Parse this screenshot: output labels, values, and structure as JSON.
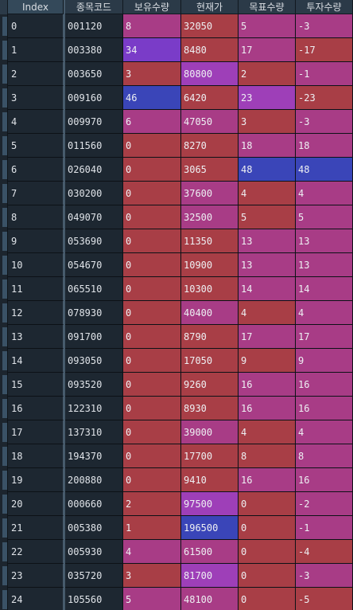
{
  "columns": [
    "Index",
    "종목코드",
    "보유수량",
    "현재가",
    "목표수량",
    "투자수량"
  ],
  "colors": {
    "red": "#a83e46",
    "magenta": "#a83c86",
    "violet": "#7a3cc8",
    "blue": "#3a45b8",
    "purple": "#9e3fb8",
    "dark": "#1d2731"
  },
  "rows": [
    {
      "index": "0",
      "code": "001120",
      "hold": "8",
      "price": "32050",
      "target": "5",
      "invest": "-3",
      "c": [
        "magenta",
        "red",
        "magenta",
        "magenta"
      ]
    },
    {
      "index": "1",
      "code": "003380",
      "hold": "34",
      "price": "8480",
      "target": "17",
      "invest": "-17",
      "c": [
        "violet",
        "red",
        "magenta",
        "red"
      ]
    },
    {
      "index": "2",
      "code": "003650",
      "hold": "3",
      "price": "80800",
      "target": "2",
      "invest": "-1",
      "c": [
        "red",
        "purple",
        "red",
        "magenta"
      ]
    },
    {
      "index": "3",
      "code": "009160",
      "hold": "46",
      "price": "6420",
      "target": "23",
      "invest": "-23",
      "c": [
        "blue",
        "red",
        "purple",
        "red"
      ]
    },
    {
      "index": "4",
      "code": "009970",
      "hold": "6",
      "price": "47050",
      "target": "3",
      "invest": "-3",
      "c": [
        "magenta",
        "magenta",
        "red",
        "magenta"
      ]
    },
    {
      "index": "5",
      "code": "011560",
      "hold": "0",
      "price": "8270",
      "target": "18",
      "invest": "18",
      "c": [
        "red",
        "red",
        "magenta",
        "magenta"
      ]
    },
    {
      "index": "6",
      "code": "026040",
      "hold": "0",
      "price": "3065",
      "target": "48",
      "invest": "48",
      "c": [
        "red",
        "red",
        "blue",
        "blue"
      ]
    },
    {
      "index": "7",
      "code": "030200",
      "hold": "0",
      "price": "37600",
      "target": "4",
      "invest": "4",
      "c": [
        "red",
        "magenta",
        "red",
        "magenta"
      ]
    },
    {
      "index": "8",
      "code": "049070",
      "hold": "0",
      "price": "32500",
      "target": "5",
      "invest": "5",
      "c": [
        "red",
        "magenta",
        "red",
        "magenta"
      ]
    },
    {
      "index": "9",
      "code": "053690",
      "hold": "0",
      "price": "11350",
      "target": "13",
      "invest": "13",
      "c": [
        "red",
        "red",
        "magenta",
        "magenta"
      ]
    },
    {
      "index": "10",
      "code": "054670",
      "hold": "0",
      "price": "10900",
      "target": "13",
      "invest": "13",
      "c": [
        "red",
        "red",
        "magenta",
        "magenta"
      ]
    },
    {
      "index": "11",
      "code": "065510",
      "hold": "0",
      "price": "10300",
      "target": "14",
      "invest": "14",
      "c": [
        "red",
        "red",
        "magenta",
        "magenta"
      ]
    },
    {
      "index": "12",
      "code": "078930",
      "hold": "0",
      "price": "40400",
      "target": "4",
      "invest": "4",
      "c": [
        "red",
        "magenta",
        "red",
        "magenta"
      ]
    },
    {
      "index": "13",
      "code": "091700",
      "hold": "0",
      "price": "8790",
      "target": "17",
      "invest": "17",
      "c": [
        "red",
        "red",
        "magenta",
        "magenta"
      ]
    },
    {
      "index": "14",
      "code": "093050",
      "hold": "0",
      "price": "17050",
      "target": "9",
      "invest": "9",
      "c": [
        "red",
        "red",
        "red",
        "magenta"
      ]
    },
    {
      "index": "15",
      "code": "093520",
      "hold": "0",
      "price": "9260",
      "target": "16",
      "invest": "16",
      "c": [
        "red",
        "red",
        "magenta",
        "magenta"
      ]
    },
    {
      "index": "16",
      "code": "122310",
      "hold": "0",
      "price": "8930",
      "target": "16",
      "invest": "16",
      "c": [
        "red",
        "red",
        "magenta",
        "magenta"
      ]
    },
    {
      "index": "17",
      "code": "137310",
      "hold": "0",
      "price": "39000",
      "target": "4",
      "invest": "4",
      "c": [
        "red",
        "magenta",
        "red",
        "magenta"
      ]
    },
    {
      "index": "18",
      "code": "194370",
      "hold": "0",
      "price": "17700",
      "target": "8",
      "invest": "8",
      "c": [
        "red",
        "red",
        "red",
        "magenta"
      ]
    },
    {
      "index": "19",
      "code": "200880",
      "hold": "0",
      "price": "9410",
      "target": "16",
      "invest": "16",
      "c": [
        "red",
        "red",
        "magenta",
        "magenta"
      ]
    },
    {
      "index": "20",
      "code": "000660",
      "hold": "2",
      "price": "97500",
      "target": "0",
      "invest": "-2",
      "c": [
        "red",
        "purple",
        "red",
        "magenta"
      ]
    },
    {
      "index": "21",
      "code": "005380",
      "hold": "1",
      "price": "196500",
      "target": "0",
      "invest": "-1",
      "c": [
        "red",
        "blue",
        "red",
        "magenta"
      ]
    },
    {
      "index": "22",
      "code": "005930",
      "hold": "4",
      "price": "61500",
      "target": "0",
      "invest": "-4",
      "c": [
        "magenta",
        "magenta",
        "red",
        "red"
      ]
    },
    {
      "index": "23",
      "code": "035720",
      "hold": "3",
      "price": "81700",
      "target": "0",
      "invest": "-3",
      "c": [
        "red",
        "purple",
        "red",
        "magenta"
      ]
    },
    {
      "index": "24",
      "code": "105560",
      "hold": "5",
      "price": "48100",
      "target": "0",
      "invest": "-5",
      "c": [
        "magenta",
        "magenta",
        "red",
        "red"
      ]
    }
  ]
}
